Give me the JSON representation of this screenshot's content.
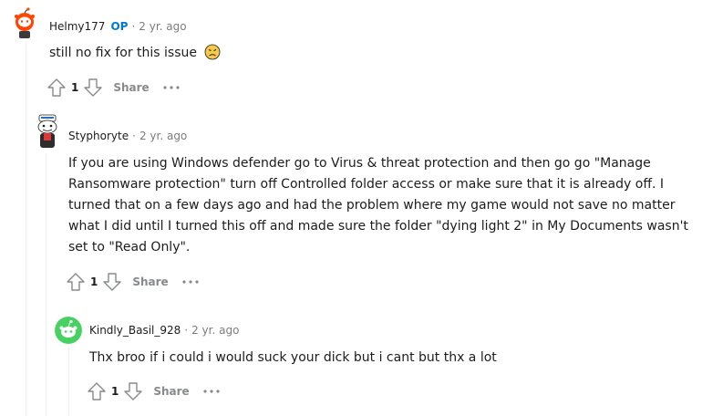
{
  "comments": [
    {
      "username": "Helmy177",
      "op_badge": "OP",
      "separator": "·",
      "time": "2 yr. ago",
      "body": "still no fix for this issue",
      "emoji_icon": "disappointed-face-emoji",
      "votes": "1",
      "share_label": "Share"
    },
    {
      "username": "Styphoryte",
      "separator": "·",
      "time": "2 yr. ago",
      "body": "If you are using Windows defender go to Virus & threat protection and then go go \"Manage Ransomware protection\" turn off Controlled folder access or make sure that it is already off. I turned that on a few days ago and had the problem where my game would not save no matter what I did until I turned this off and made sure the folder \"dying light 2\" in My Documents wasn't set to \"Read Only\".",
      "votes": "1",
      "share_label": "Share"
    },
    {
      "username": "Kindly_Basil_928",
      "separator": "·",
      "time": "2 yr. ago",
      "body": "Thx broo if i could i would suck your dick but i cant but thx a lot",
      "votes": "1",
      "share_label": "Share"
    }
  ],
  "colors": {
    "op": "#0079d3",
    "meta": "#7c7c7c",
    "action": "#878a8c",
    "thread_line": "#edeff1",
    "snoo_green": "#46d160",
    "snoo_orange": "#ff4500"
  }
}
